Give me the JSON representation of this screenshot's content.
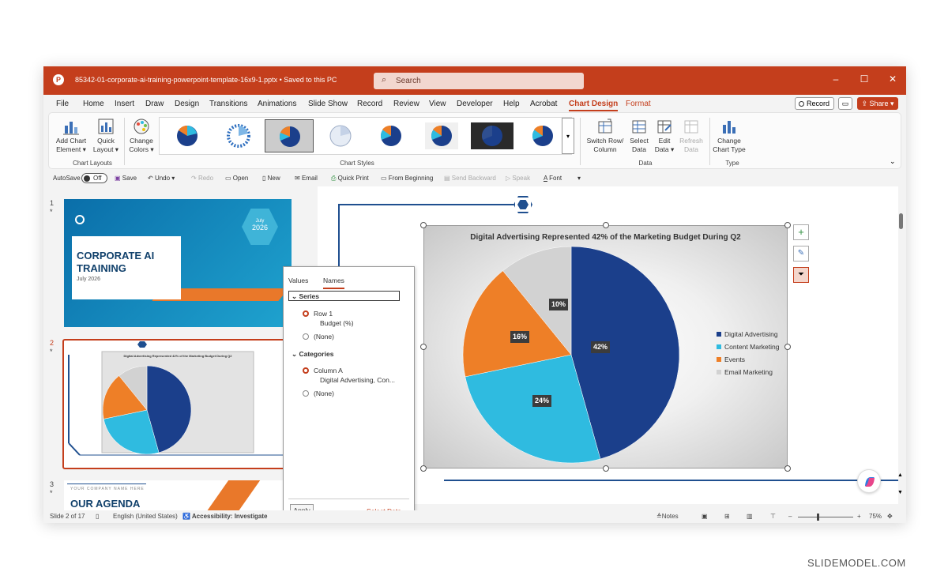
{
  "titlebar": {
    "filename": "85342-01-corporate-ai-training-powerpoint-template-16x9-1.pptx • Saved to this PC",
    "search_placeholder": "Search"
  },
  "menu": {
    "items": [
      "File",
      "Home",
      "Insert",
      "Draw",
      "Design",
      "Transitions",
      "Animations",
      "Slide Show",
      "Record",
      "Review",
      "View",
      "Developer",
      "Help",
      "Acrobat",
      "Chart Design",
      "Format"
    ],
    "active": "Chart Design",
    "record_label": "Record",
    "share_label": "Share"
  },
  "ribbon": {
    "add_chart_element": "Add Chart Element",
    "quick_layout": "Quick Layout",
    "change_colors": "Change Colors",
    "switch_row_column": "Switch Row/ Column",
    "select_data": "Select Data",
    "edit_data": "Edit Data",
    "refresh_data": "Refresh Data",
    "change_chart_type": "Change Chart Type",
    "groups": {
      "chart_layouts": "Chart Layouts",
      "chart_styles": "Chart Styles",
      "data": "Data",
      "type": "Type"
    }
  },
  "qat": {
    "autosave": "AutoSave",
    "autosave_state": "Off",
    "save": "Save",
    "undo": "Undo",
    "redo": "Redo",
    "open": "Open",
    "new": "New",
    "email": "Email",
    "quick_print": "Quick Print",
    "from_beginning": "From Beginning",
    "send_backward": "Send Backward",
    "speak": "Speak",
    "font": "Font"
  },
  "thumbnails": {
    "slide1": {
      "number": "1",
      "title": "CORPORATE AI TRAINING",
      "date": "July 2026",
      "badge_month": "July",
      "badge_year": "2026"
    },
    "slide2": {
      "number": "2",
      "title": "Digital Advertising Represented 42% of the Marketing Budget During Q2"
    },
    "slide3": {
      "number": "3",
      "company": "YOUR COMPANY NAME HERE",
      "title": "OUR AGENDA"
    }
  },
  "filter_panel": {
    "tab_values": "Values",
    "tab_names": "Names",
    "series_header": "Series",
    "series_row": "Row 1",
    "series_row_value": "Budget (%)",
    "series_none": "(None)",
    "categories_header": "Categories",
    "categories_col": "Column A",
    "categories_col_value": "Digital Advertising, Con...",
    "categories_none": "(None)",
    "apply": "Apply",
    "select_data": "Select Data..."
  },
  "chart_data": {
    "type": "pie",
    "title": "Digital Advertising Represented 42% of the Marketing Budget During Q2",
    "categories": [
      "Digital Advertising",
      "Content Marketing",
      "Events",
      "Email Marketing"
    ],
    "values": [
      42,
      24,
      16,
      10
    ],
    "labels": [
      "42%",
      "24%",
      "16%",
      "10%"
    ],
    "colors": [
      "#1b3f8b",
      "#2fbbe0",
      "#ee7f27",
      "#d2d2d2"
    ],
    "legend_position": "right"
  },
  "statusbar": {
    "slide_of": "Slide 2 of 17",
    "language": "English (United States)",
    "accessibility": "Accessibility: Investigate",
    "notes": "Notes",
    "zoom": "75%"
  },
  "watermark": "SLIDEMODEL.COM"
}
